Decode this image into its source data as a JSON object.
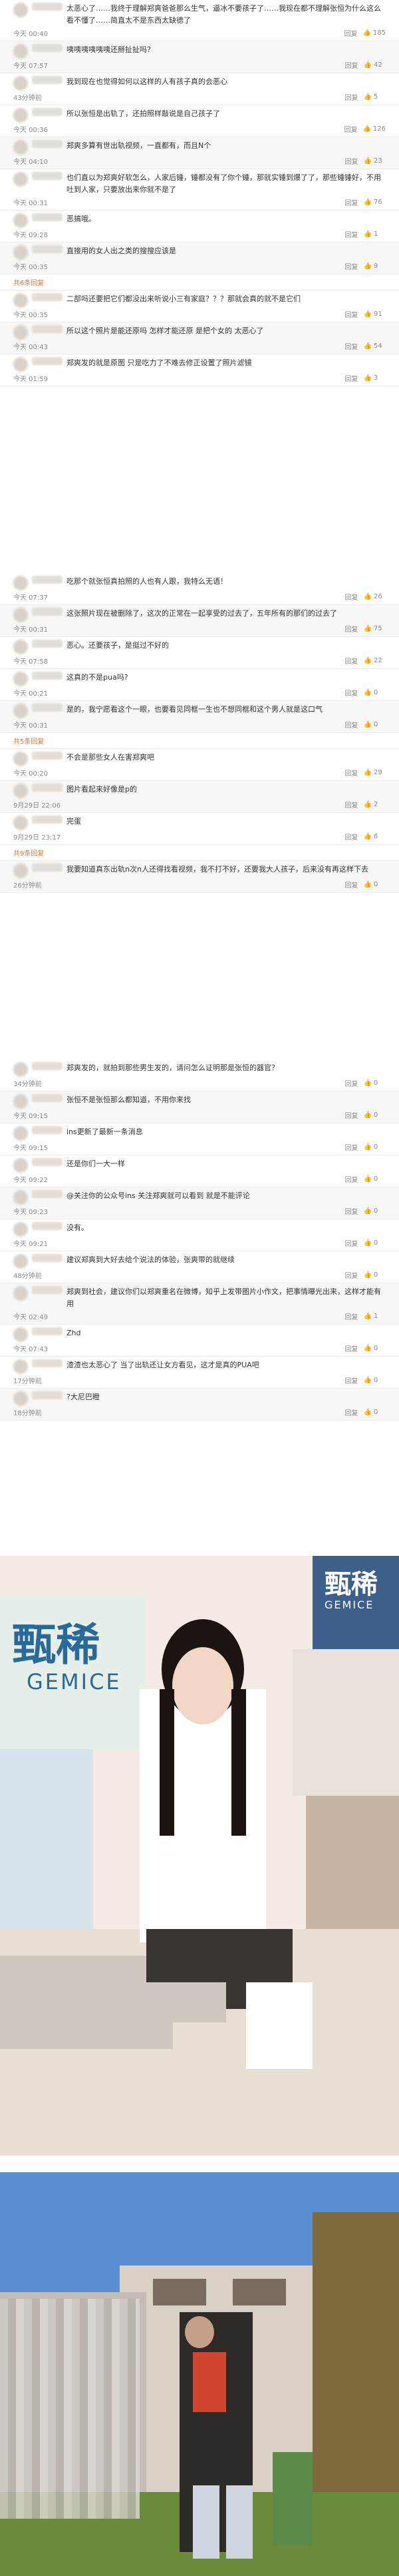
{
  "comments_a": [
    {
      "text": "太恶心了……我终于理解郑爽爸爸那么生气，逼冰不要孩子了……我现在都不理解张恒为什么这么看不懂了……简直太不是东西太缺德了",
      "time": "今天 00:40",
      "reply": "回复",
      "likes": "185"
    },
    {
      "text": "咦咦咦咦咦咦还掰扯扯吗？",
      "time": "今天 07:57",
      "reply": "回复",
      "likes": "42"
    },
    {
      "text": "我到现在也觉得如何以这样的人有孩子真的会恶心",
      "time": "43分钟前",
      "reply": "回复",
      "likes": "5"
    },
    {
      "text": "所以张恒是出轨了，还拍照样敲说是自己孩子了",
      "time": "今天 00:36",
      "reply": "回复",
      "likes": "126"
    },
    {
      "text": "郑爽多算有世出轨视频，一直都有，而且N个",
      "time": "今天 04:10",
      "reply": "回复",
      "likes": "23"
    },
    {
      "text": "也们直以为郑爽好软怎么，人家后锤，锤都没有了你个锤，那就实锤到爆了了，那些锤锤好，不用吐到人家，只要放出来你就不是了",
      "time": "今天 00:31",
      "reply": "回复",
      "likes": "76"
    },
    {
      "text": "恶搞哦。",
      "time": "今天 09:28",
      "reply": "回复",
      "likes": "1"
    },
    {
      "text": "直接用的女人出之类的搜搜应该是",
      "time": "今天 00:35",
      "reply": "回复",
      "likes": "9"
    },
    {
      "text": "共6条回复",
      "is_expand": true
    },
    {
      "text": "二部吗还要把它们都没出来听说小三有家庭？？？那就会真的就不是它们",
      "time": "今天 00:35",
      "reply": "回复",
      "likes": "91"
    },
    {
      "text": "所以这个照片是能还原吗 怎样才能还原 是把个女的 太恶心了",
      "time": "今天 00:43",
      "reply": "回复",
      "likes": "54"
    },
    {
      "text": "郑爽发的就是原图 只是吃力了不难去修正设置了照片滤镜",
      "time": "今天 01:59",
      "reply": "回复",
      "likes": "3"
    }
  ],
  "comments_b": [
    {
      "text": "吃那个就张恒真拍照的人也有人跟，我特么无语！",
      "time": "今天 07:37",
      "reply": "回复",
      "likes": "26"
    },
    {
      "text": "这张照片现在被删除了，这次的正常在一起享受的过去了，五年所有的那们的过去了",
      "time": "今天 00:31",
      "reply": "回复",
      "likes": "75"
    },
    {
      "text": "恶心。还要孩子，是挺过不好的",
      "time": "今天 07:58",
      "reply": "回复",
      "likes": "22"
    },
    {
      "text": "这真的不是pua吗?",
      "time": "今天 00:21",
      "reply": "回复",
      "likes": "0"
    },
    {
      "text": "是的，我宁愿看这个一眼，也要看见同框一生也不想同框和这个男人就是这口气",
      "time": "今天 00:31",
      "reply": "回复",
      "likes": "0"
    },
    {
      "text": "共5条回复",
      "is_expand": true
    },
    {
      "text": "不会是那些女人在害郑爽吧",
      "time": "今天 00:20",
      "reply": "回复",
      "likes": "29"
    },
    {
      "text": "图片看起来好像是p的",
      "time": "9月29日 22:06",
      "reply": "回复",
      "likes": "2"
    },
    {
      "text": "完蛋",
      "time": "9月29日 23:17",
      "reply": "回复",
      "likes": "6"
    },
    {
      "text": "共9条回复",
      "is_expand": true
    },
    {
      "text": "我要知道真东出轨n次n人还得找看视频，我不打不好，还要我大人孩子，后来没有再这样下去",
      "time": "26分钟前",
      "reply": "回复",
      "likes": "0"
    }
  ],
  "comments_c": [
    {
      "text": "郑爽发的，就拍到那些男生发的，请问怎么证明那是张恒的器官？",
      "time": "34分钟前",
      "reply": "回复",
      "likes": "0"
    },
    {
      "text": "张恒不是张恒那么都知道，不用你来找",
      "time": "今天 09:15",
      "reply": "回复",
      "likes": "0"
    },
    {
      "text": "ins更新了最新一条消息",
      "time": "今天 09:15",
      "reply": "回复",
      "likes": "0"
    },
    {
      "text": "还是你们一大一样",
      "time": "今天 09:22",
      "reply": "回复",
      "likes": "0"
    },
    {
      "text": "@关注你的公众号ins 关注郑爽就可以看到 就是不能评论",
      "time": "今天 09:23",
      "reply": "回复",
      "likes": "0"
    },
    {
      "text": "没有。",
      "time": "今天 09:21",
      "reply": "回复",
      "likes": "0"
    },
    {
      "text": "建议郑爽到大好去给个说法的体验，张爽带的就继续",
      "time": "48分钟前",
      "reply": "回复",
      "likes": "0"
    },
    {
      "text": "郑爽到社会，建议你们以郑爽重名在微博，知乎上发带图片小作文，把事情曝光出来，这样才能有用",
      "time": "今天 02:49",
      "reply": "回复",
      "likes": "1"
    },
    {
      "text": "Zhd",
      "time": "今天 07:43",
      "reply": "回复",
      "likes": "0"
    },
    {
      "text": "渣渣也太恶心了 当了出轨还让女方看见，这才是真的PUA吧",
      "time": "17分钟前",
      "reply": "回复",
      "likes": "0"
    },
    {
      "text": "?大尼巴瞪",
      "time": "18分钟前",
      "reply": "回复",
      "likes": "0"
    }
  ],
  "photo1": {
    "brand_left": "甄稀",
    "brand_left_en": "GEMICE",
    "brand_right": "甄稀",
    "brand_right_en": "GEMICE"
  },
  "colors": {
    "accent": "#e07030",
    "text": "#333333",
    "meta": "#8a8a8a"
  }
}
